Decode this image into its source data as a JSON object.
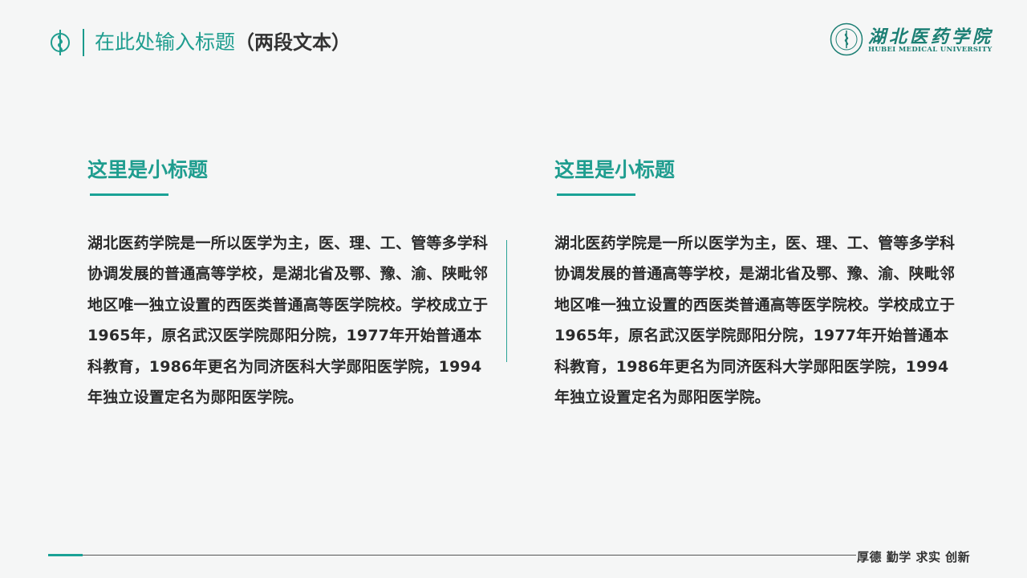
{
  "header": {
    "title": "在此处输入标题",
    "title_suffix": "（两段文本）"
  },
  "brand": {
    "name_cn": "湖北医药学院",
    "name_en": "HUBEI MEDICAL UNIVERSITY"
  },
  "columns": [
    {
      "subtitle": "这里是小标题",
      "body": "湖北医药学院是一所以医学为主，医、理、工、管等多学科协调发展的普通高等学校，是湖北省及鄂、豫、渝、陕毗邻地区唯一独立设置的西医类普通高等医学院校。学校成立于1965年，原名武汉医学院郧阳分院，1977年开始普通本科教育，1986年更名为同济医科大学郧阳医学院，1994年独立设置定名为郧阳医学院。"
    },
    {
      "subtitle": "这里是小标题",
      "body": "湖北医药学院是一所以医学为主，医、理、工、管等多学科协调发展的普通高等学校，是湖北省及鄂、豫、渝、陕毗邻地区唯一独立设置的西医类普通高等医学院校。学校成立于1965年，原名武汉医学院郧阳分院，1977年开始普通本科教育，1986年更名为同济医科大学郧阳医学院，1994年独立设置定名为郧阳医学院。"
    }
  ],
  "footer": {
    "motto": "厚德 勤学 求实 创新"
  },
  "colors": {
    "accent": "#1f9d8f",
    "text": "#2b2b2b",
    "background": "#f5f6f6"
  }
}
